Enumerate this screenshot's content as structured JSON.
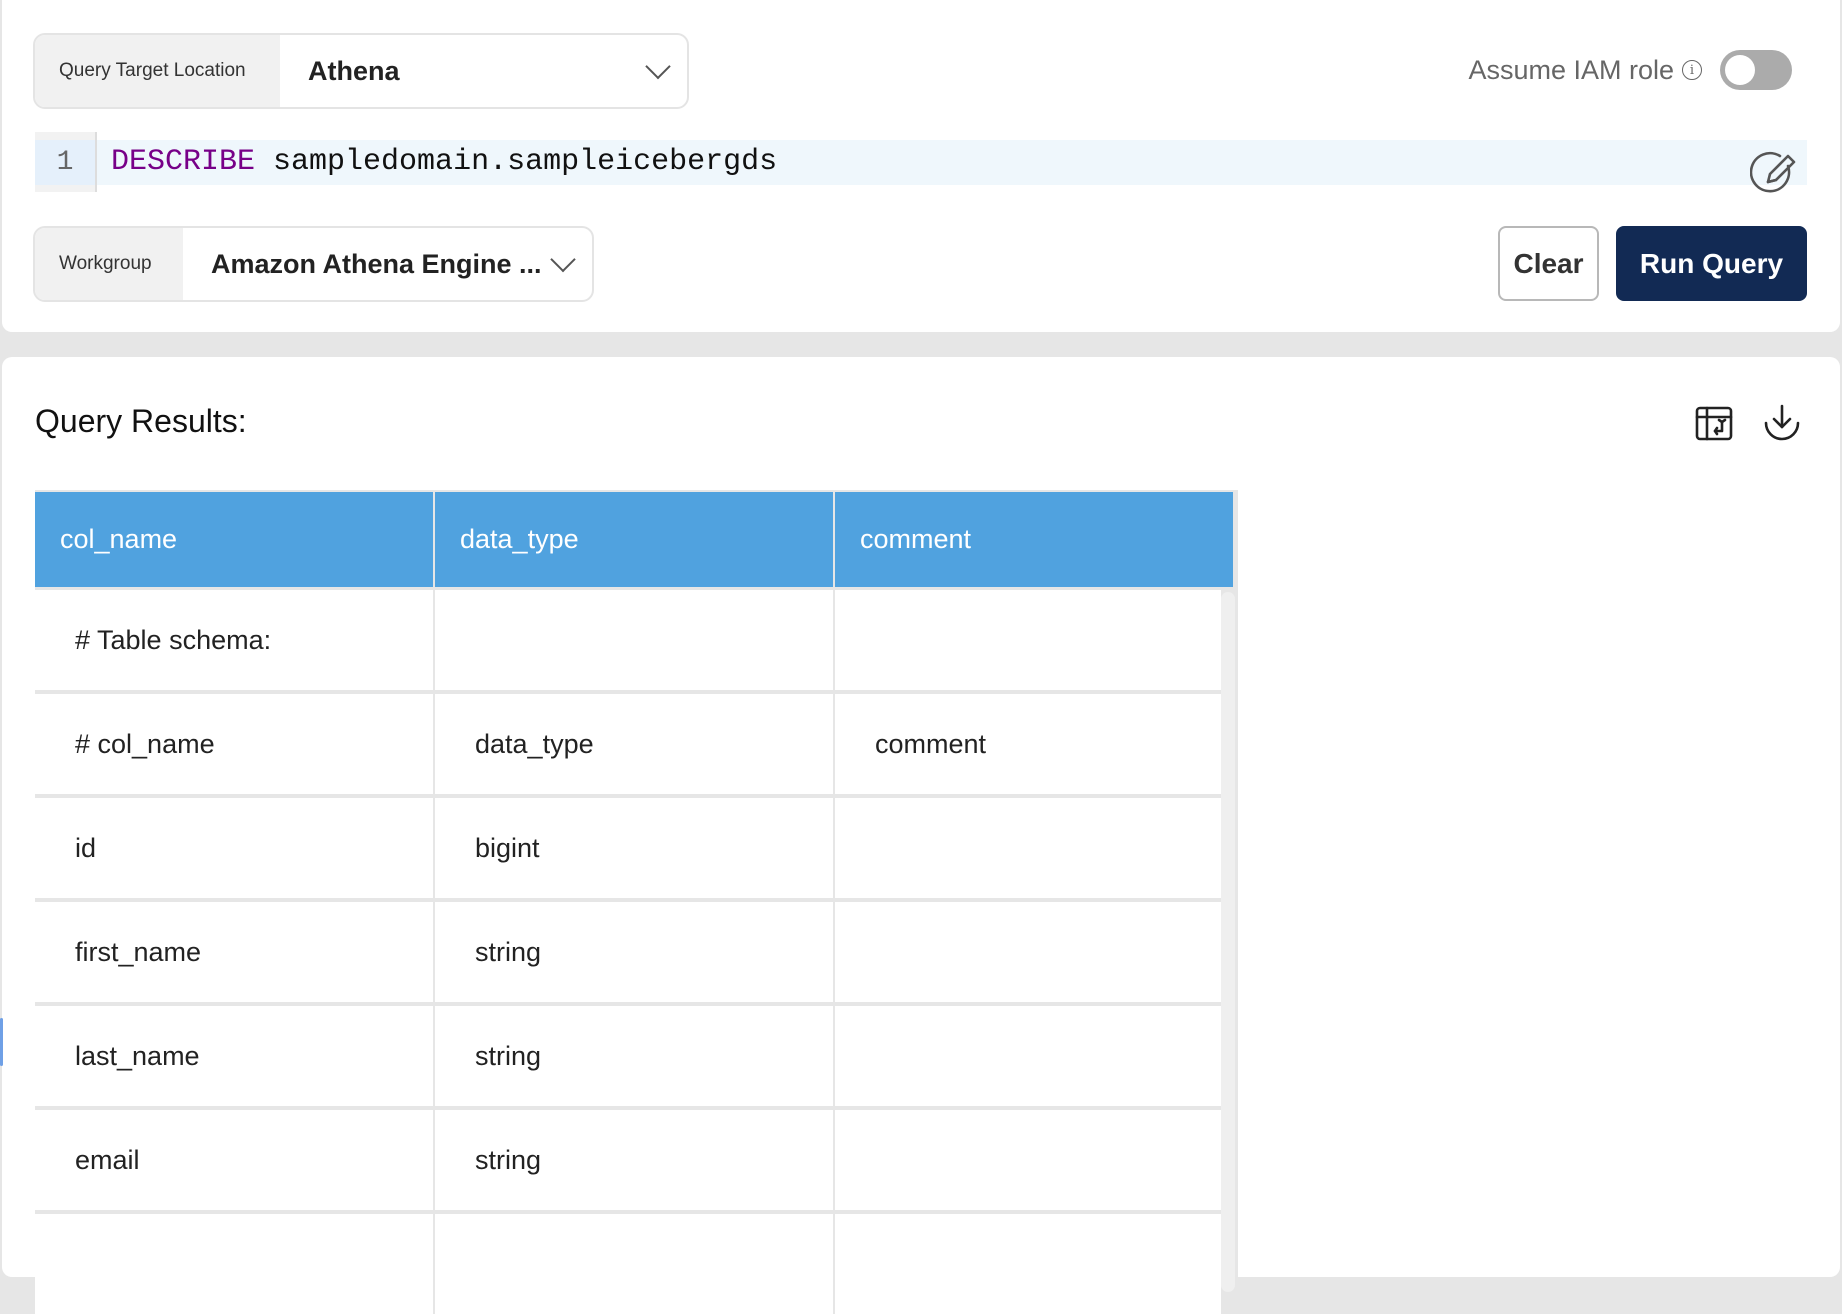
{
  "query_target": {
    "label": "Query Target Location",
    "value": "Athena"
  },
  "assume_iam_role": {
    "label": "Assume IAM role",
    "info_icon": "i",
    "enabled": false
  },
  "editor": {
    "line_number": "1",
    "keyword": "DESCRIBE",
    "rest": " sampledomain.sampleicebergds"
  },
  "workgroup": {
    "label": "Workgroup",
    "value": "Amazon Athena Engine ..."
  },
  "buttons": {
    "clear": "Clear",
    "run_query": "Run Query"
  },
  "results": {
    "title": "Query Results:",
    "columns": [
      "col_name",
      "data_type",
      "comment"
    ],
    "rows": [
      [
        "# Table schema:",
        "",
        ""
      ],
      [
        "# col_name",
        "data_type",
        "comment"
      ],
      [
        "id",
        "bigint",
        ""
      ],
      [
        "first_name",
        "string",
        ""
      ],
      [
        "last_name",
        "string",
        ""
      ],
      [
        "email",
        "string",
        ""
      ],
      [
        "",
        "",
        ""
      ]
    ]
  },
  "colors": {
    "header_bg": "#50a2df",
    "run_button_bg": "#122a54",
    "keyword": "#770088"
  }
}
